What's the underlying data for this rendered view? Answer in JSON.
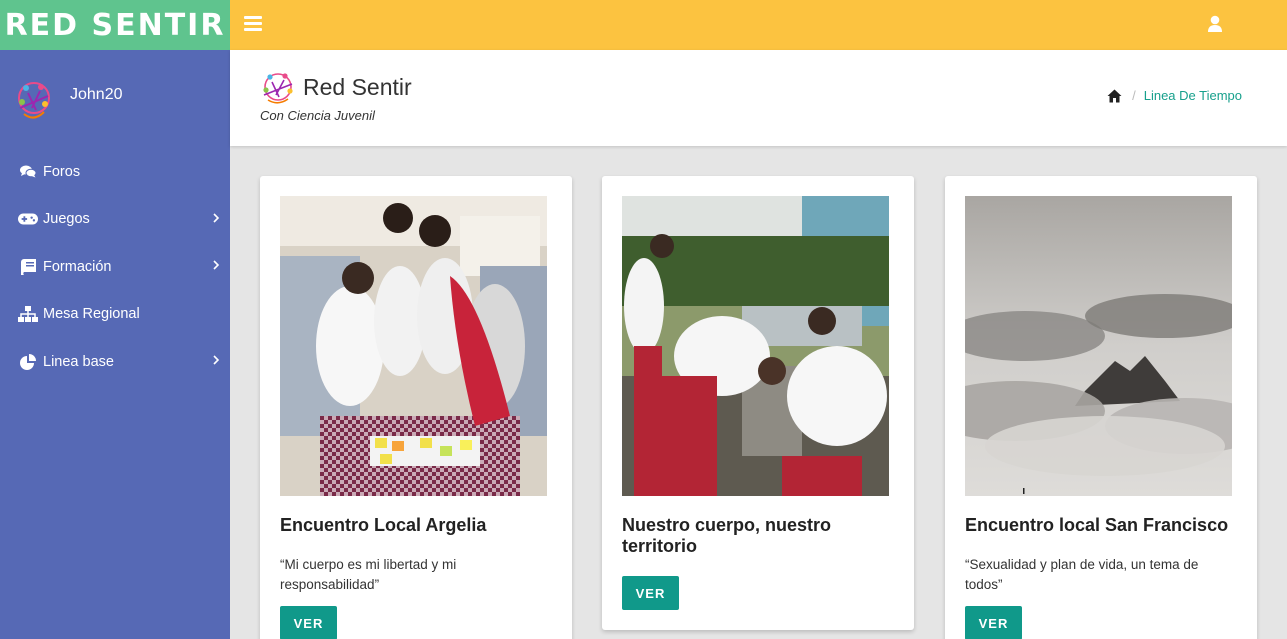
{
  "brand": {
    "name": "RED SENTIR",
    "color": "#5fc48e"
  },
  "topbar": {
    "color": "#fcc340",
    "menu_icon": "bars-icon",
    "user_icon": "user-icon"
  },
  "sidebar": {
    "color": "#5669b5",
    "user": {
      "name": "John20",
      "avatar_icon": "red-sentir-logo"
    },
    "items": [
      {
        "label": "Foros",
        "icon": "comments-icon",
        "has_submenu": false
      },
      {
        "label": "Juegos",
        "icon": "gamepad-icon",
        "has_submenu": true
      },
      {
        "label": "Formación",
        "icon": "book-icon",
        "has_submenu": true
      },
      {
        "label": "Mesa Regional",
        "icon": "sitemap-icon",
        "has_submenu": false
      },
      {
        "label": "Linea base",
        "icon": "pie-chart-icon",
        "has_submenu": true
      }
    ]
  },
  "header": {
    "title": "Red Sentir",
    "tagline": "Con Ciencia Juvenil",
    "breadcrumb": {
      "home_icon": "home-icon",
      "current": "Linea De Tiempo"
    }
  },
  "cards": [
    {
      "title": "Encuentro Local Argelia",
      "description": "“Mi cuerpo es mi libertad y mi responsabilidad”",
      "button": "VER",
      "image": "students-working-at-table-photo"
    },
    {
      "title": "Nuestro cuerpo, nuestro territorio",
      "description": "",
      "button": "VER",
      "image": "students-outdoor-activity-photo"
    },
    {
      "title": "Encuentro local San Francisco",
      "description": "“Sexualidad y plan de vida, un tema de todos”",
      "button": "VER",
      "image": "misty-mountain-photo"
    }
  ],
  "accent_color": "#10998a"
}
